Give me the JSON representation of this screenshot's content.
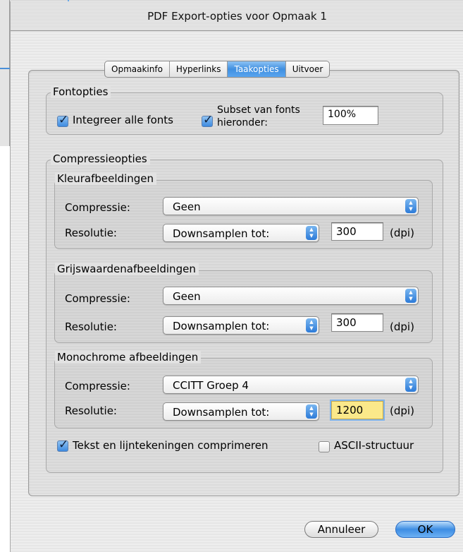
{
  "dialog": {
    "title": "PDF Export-opties voor Opmaak 1"
  },
  "tabs": [
    {
      "label": "Opmaakinfo",
      "active": false
    },
    {
      "label": "Hyperlinks",
      "active": false
    },
    {
      "label": "Taakopties",
      "active": true
    },
    {
      "label": "Uitvoer",
      "active": false
    }
  ],
  "font_options": {
    "legend": "Fontopties",
    "embed_all": {
      "label": "Integreer alle fonts",
      "checked": true
    },
    "subset": {
      "label_line1": "Subset van fonts",
      "label_line2": "hieronder:",
      "checked": true,
      "value": "100%"
    }
  },
  "compression": {
    "legend": "Compressieopties",
    "color": {
      "legend": "Kleurafbeeldingen",
      "compression_label": "Compressie:",
      "compression_value": "Geen",
      "resolution_label": "Resolutie:",
      "resolution_mode": "Downsamplen tot:",
      "resolution_value": "300",
      "unit": "(dpi)"
    },
    "grayscale": {
      "legend": "Grijswaardenafbeeldingen",
      "compression_label": "Compressie:",
      "compression_value": "Geen",
      "resolution_label": "Resolutie:",
      "resolution_mode": "Downsamplen tot:",
      "resolution_value": "300",
      "unit": "(dpi)"
    },
    "monochrome": {
      "legend": "Monochrome afbeeldingen",
      "compression_label": "Compressie:",
      "compression_value": "CCITT Groep 4",
      "resolution_label": "Resolutie:",
      "resolution_mode": "Downsamplen tot:",
      "resolution_value": "1200",
      "unit": "(dpi)"
    },
    "compress_text": {
      "label": "Tekst en lijntekeningen comprimeren",
      "checked": true
    },
    "ascii": {
      "label": "ASCII-structuur",
      "checked": false
    }
  },
  "buttons": {
    "cancel": "Annuleer",
    "ok": "OK"
  },
  "colors": {
    "accent": "#3d8de3",
    "highlight_field": "#fbe98a"
  },
  "icons": {
    "checkmark": "checkmark-icon",
    "popup_arrows": "up-down-arrows-icon"
  }
}
